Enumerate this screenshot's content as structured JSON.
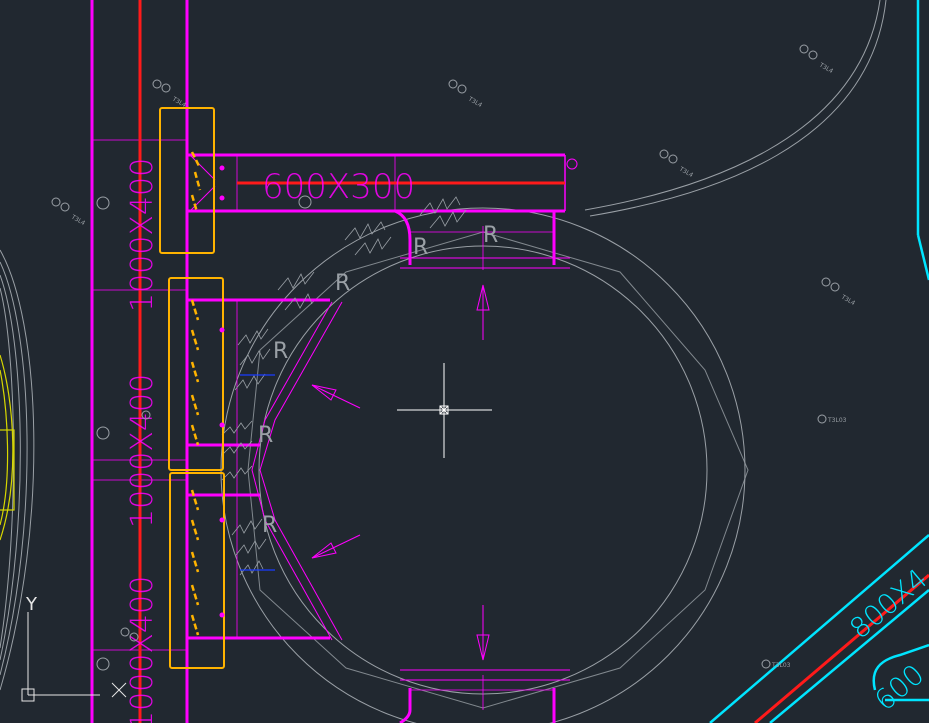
{
  "drawing": {
    "duct_horizontal_label": "600X300",
    "duct_vertical_labels": [
      "1000X400",
      "1000X400",
      "1000X400"
    ],
    "duct_diagonal_label": "800X4",
    "duct_diagonal_label_2": "600",
    "radius_marker": "R",
    "small_tags": [
      "T3L4",
      "T3L4",
      "T3L4",
      "T3L4",
      "T3L4",
      "T3L4",
      "T3L03",
      "T3L03"
    ]
  },
  "colors": {
    "background": "#212830",
    "duct_magenta": "#ff00ff",
    "centerline_red": "#ff1a1a",
    "highlight_orange": "#ffb300",
    "duct_cyan": "#00e5ff",
    "curve_gray": "#9aa0a6",
    "outline_yellow": "#d8d800"
  },
  "ucs": {
    "x_label": "",
    "y_label": "Y"
  },
  "crosshair": "crosshair-cursor"
}
